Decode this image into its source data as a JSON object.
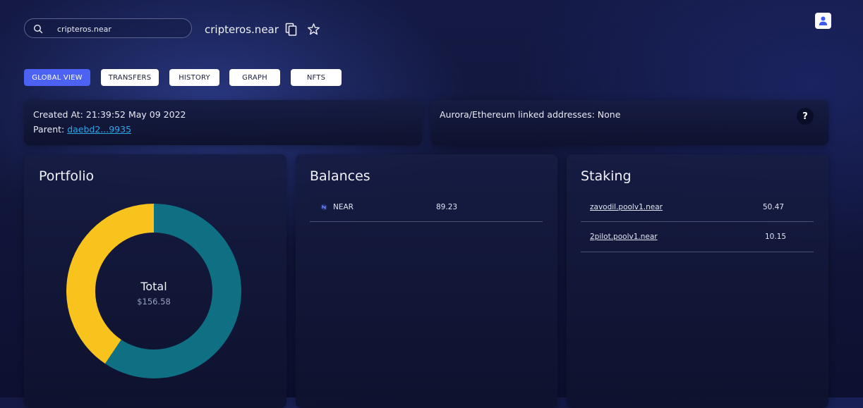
{
  "search": {
    "value": "cripteros.near"
  },
  "account": {
    "name": "cripteros.near"
  },
  "tabs": [
    {
      "label": "GLOBAL VIEW",
      "active": true
    },
    {
      "label": "TRANSFERS",
      "active": false
    },
    {
      "label": "HISTORY",
      "active": false
    },
    {
      "label": "GRAPH",
      "active": false
    },
    {
      "label": "NFTS",
      "active": false
    }
  ],
  "info": {
    "created_at": "Created At: 21:39:52 May 09 2022",
    "parent_label": "Parent: ",
    "parent_link": "daebd2...9935",
    "linked": "Aurora/Ethereum linked addresses: None",
    "help": "?"
  },
  "portfolio": {
    "title": "Portfolio",
    "total_label": "Total",
    "total_value": "$156.58",
    "chart_data": {
      "type": "pie",
      "categories": [
        "Teal segment",
        "Yellow segment"
      ],
      "values": [
        59.4,
        40.6
      ],
      "colors": [
        "#0e7082",
        "#f8c31d"
      ],
      "donut": true
    }
  },
  "balances": {
    "title": "Balances",
    "rows": [
      {
        "token": "NEAR",
        "amount": "89.23"
      }
    ]
  },
  "staking": {
    "title": "Staking",
    "rows": [
      {
        "pool": "zavodil.poolv1.near",
        "amount": "50.47"
      },
      {
        "pool": "2pilot.poolv1.near",
        "amount": "10.15"
      }
    ]
  },
  "colors": {
    "accent": "#4b62f2",
    "link": "#2ea6e6",
    "background": "#12173d"
  }
}
